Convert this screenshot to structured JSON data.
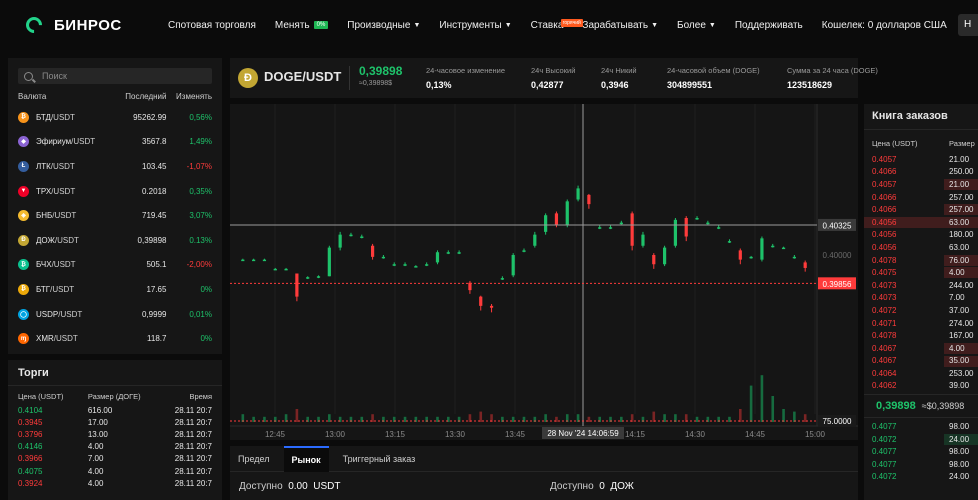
{
  "brand": {
    "name": "БИНРОС"
  },
  "nav": {
    "items": [
      {
        "label": "Спотовая торговля"
      },
      {
        "label": "Менять",
        "badge": "0%"
      },
      {
        "label": "Производные",
        "caret": true
      },
      {
        "label": "Инструменты",
        "caret": true
      },
      {
        "label": "Ставка",
        "badge": "горячий"
      },
      {
        "label": "Зарабатывать",
        "caret": true
      },
      {
        "label": "Более",
        "caret": true
      },
      {
        "label": "Поддерживать"
      },
      {
        "label": "Кошелек: 0 долларов США"
      }
    ],
    "cut_label": "Н"
  },
  "markets": {
    "search_placeholder": "Поиск",
    "headers": {
      "pair": "Валюта",
      "last": "Последний",
      "change": "Изменять"
    },
    "rows": [
      {
        "base": "БТД",
        "quote": "/USDT",
        "last": "95262.99",
        "change": "0,56%",
        "dir": "up",
        "icon": "bitcoin-icon",
        "color": "#f7931a",
        "glyph": "₿"
      },
      {
        "base": "Эфириум",
        "quote": "/USDT",
        "last": "3567.8",
        "change": "1,49%",
        "dir": "up",
        "icon": "ethereum-icon",
        "color": "#8a63d2",
        "glyph": "◆"
      },
      {
        "base": "ЛТК",
        "quote": "/USDT",
        "last": "103.45",
        "change": "-1,07%",
        "dir": "down",
        "icon": "litecoin-icon",
        "color": "#345d9d",
        "glyph": "Ł"
      },
      {
        "base": "ТРХ",
        "quote": "/USDT",
        "last": "0.2018",
        "change": "0,35%",
        "dir": "up",
        "icon": "tron-icon",
        "color": "#ef0027",
        "glyph": "▼"
      },
      {
        "base": "БНБ",
        "quote": "/USDT",
        "last": "719.45",
        "change": "3,07%",
        "dir": "up",
        "icon": "bnb-icon",
        "color": "#f3ba2f",
        "glyph": "◈"
      },
      {
        "base": "ДОЖ",
        "quote": "/USDT",
        "last": "0,39898",
        "change": "0.13%",
        "dir": "up",
        "icon": "dogecoin-icon",
        "color": "#c2a633",
        "glyph": "Ð"
      },
      {
        "base": "БЧХ",
        "quote": "/USDT",
        "last": "505.1",
        "change": "-2,00%",
        "dir": "down",
        "icon": "bitcoin-cash-icon",
        "color": "#0ac18e",
        "glyph": "₿"
      },
      {
        "base": "БТГ",
        "quote": "/USDT",
        "last": "17.65",
        "change": "0%",
        "dir": "up",
        "icon": "bitcoin-gold-icon",
        "color": "#eba809",
        "glyph": "₿"
      },
      {
        "base": "USDP",
        "quote": "/USDT",
        "last": "0,9999",
        "change": "0,01%",
        "dir": "up",
        "icon": "usdp-icon",
        "color": "#00a3e0",
        "glyph": "◯"
      },
      {
        "base": "XMR",
        "quote": "/USDT",
        "last": "118.7",
        "change": "0%",
        "dir": "up",
        "icon": "monero-icon",
        "color": "#ff6600",
        "glyph": "ɱ"
      }
    ]
  },
  "trades": {
    "title": "Торги",
    "headers": {
      "price": "Цена (USDT)",
      "size": "Размер (ДОГЕ)",
      "time": "Время"
    },
    "rows": [
      {
        "price": "0.4104",
        "size": "616.00",
        "time": "28.11 20:7",
        "dir": "up"
      },
      {
        "price": "0.3945",
        "size": "17.00",
        "time": "28.11 20:7",
        "dir": "down"
      },
      {
        "price": "0.3796",
        "size": "13.00",
        "time": "28.11 20:7",
        "dir": "down"
      },
      {
        "price": "0.4146",
        "size": "4.00",
        "time": "28.11 20:7",
        "dir": "up"
      },
      {
        "price": "0.3966",
        "size": "7.00",
        "time": "28.11 20:7",
        "dir": "down"
      },
      {
        "price": "0.4075",
        "size": "4.00",
        "time": "28.11 20:7",
        "dir": "up"
      },
      {
        "price": "0.3924",
        "size": "4.00",
        "time": "28.11 20:7",
        "dir": "down"
      }
    ]
  },
  "ticker": {
    "glyph": "Ð",
    "pair": "DOGE/USDT",
    "price": "0,39898",
    "price_usd": "≈0,39898$",
    "stats": [
      {
        "label": "24-часовое изменение",
        "value": "0,13%",
        "color": "green"
      },
      {
        "label": "24ч Высокий",
        "value": "0,42877"
      },
      {
        "label": "24ч Никий",
        "value": "0,3946"
      },
      {
        "label": "24-часовой объем (DOGE)",
        "value": "304899551"
      },
      {
        "label": "Сумма за 24 часа (DOGE)",
        "value": "123518629"
      }
    ]
  },
  "chart_data": {
    "type": "candlestick",
    "price_ylim": [
      0.388,
      0.412
    ],
    "x_ticks": [
      "12:45",
      "13:00",
      "13:15",
      "13:30",
      "13:45",
      "14:00",
      "14:15",
      "14:30",
      "14:45",
      "15:00"
    ],
    "crosshair": {
      "time_label": "28 Nov '24  14:06:59",
      "price_label": "0.40325",
      "price": 0.40325
    },
    "last_price": {
      "label": "0.39856",
      "value": 0.39856
    },
    "axis_labels": [
      "0.40000"
    ],
    "volume_label": "75.0000",
    "candles": [
      [
        0.3995,
        0.3996,
        0.3994,
        0.3995
      ],
      [
        0.3995,
        0.3996,
        0.3994,
        0.3995
      ],
      [
        0.3995,
        0.3996,
        0.3994,
        0.3995
      ],
      [
        0.3985,
        0.3986,
        0.3984,
        0.3985
      ],
      [
        0.3985,
        0.3986,
        0.3984,
        0.3985
      ],
      [
        0.398,
        0.398,
        0.395,
        0.3955
      ],
      [
        0.3975,
        0.3977,
        0.3974,
        0.3976
      ],
      [
        0.3976,
        0.3978,
        0.3975,
        0.3977
      ],
      [
        0.3977,
        0.401,
        0.3977,
        0.4008
      ],
      [
        0.4008,
        0.4025,
        0.4005,
        0.4022
      ],
      [
        0.4022,
        0.4024,
        0.402,
        0.4022
      ],
      [
        0.402,
        0.4022,
        0.4018,
        0.402
      ],
      [
        0.401,
        0.4012,
        0.3995,
        0.3998
      ],
      [
        0.3998,
        0.4,
        0.3996,
        0.3998
      ],
      [
        0.399,
        0.3992,
        0.3988,
        0.399
      ],
      [
        0.399,
        0.3992,
        0.3988,
        0.399
      ],
      [
        0.3988,
        0.3989,
        0.3987,
        0.3988
      ],
      [
        0.399,
        0.3992,
        0.3988,
        0.399
      ],
      [
        0.3992,
        0.4005,
        0.399,
        0.4003
      ],
      [
        0.4003,
        0.4005,
        0.4001,
        0.4003
      ],
      [
        0.4003,
        0.4005,
        0.4001,
        0.4003
      ],
      [
        0.397,
        0.3972,
        0.3958,
        0.3962
      ],
      [
        0.3955,
        0.3956,
        0.394,
        0.3945
      ],
      [
        0.3945,
        0.3947,
        0.3938,
        0.3943
      ],
      [
        0.3975,
        0.3977,
        0.3973,
        0.3975
      ],
      [
        0.3978,
        0.4002,
        0.3976,
        0.4
      ],
      [
        0.4005,
        0.4007,
        0.4003,
        0.4005
      ],
      [
        0.401,
        0.4025,
        0.4008,
        0.4022
      ],
      [
        0.4025,
        0.4045,
        0.4022,
        0.4043
      ],
      [
        0.4045,
        0.4047,
        0.403,
        0.4033
      ],
      [
        0.4033,
        0.406,
        0.403,
        0.4058
      ],
      [
        0.406,
        0.4075,
        0.4058,
        0.4072
      ],
      [
        0.4065,
        0.4066,
        0.405,
        0.4055
      ],
      [
        0.403,
        0.4032,
        0.4028,
        0.403
      ],
      [
        0.403,
        0.4032,
        0.4028,
        0.403
      ],
      [
        0.4035,
        0.4037,
        0.4033,
        0.4035
      ],
      [
        0.4045,
        0.4047,
        0.4005,
        0.401
      ],
      [
        0.401,
        0.4025,
        0.4008,
        0.4022
      ],
      [
        0.4,
        0.4002,
        0.3985,
        0.399
      ],
      [
        0.399,
        0.401,
        0.3988,
        0.4008
      ],
      [
        0.401,
        0.404,
        0.4008,
        0.4038
      ],
      [
        0.404,
        0.4042,
        0.4015,
        0.402
      ],
      [
        0.404,
        0.4042,
        0.4038,
        0.404
      ],
      [
        0.4035,
        0.4037,
        0.4033,
        0.4035
      ],
      [
        0.403,
        0.4032,
        0.4028,
        0.403
      ],
      [
        0.4015,
        0.4017,
        0.4013,
        0.4015
      ],
      [
        0.4005,
        0.4007,
        0.399,
        0.3995
      ],
      [
        0.3998,
        0.3999,
        0.3996,
        0.3998
      ],
      [
        0.3995,
        0.402,
        0.3993,
        0.4018
      ],
      [
        0.401,
        0.4012,
        0.4008,
        0.401
      ],
      [
        0.4008,
        0.4009,
        0.4007,
        0.4008
      ],
      [
        0.3998,
        0.4,
        0.3996,
        0.3998
      ],
      [
        0.3992,
        0.3994,
        0.3982,
        0.3986
      ]
    ],
    "volumes": [
      3,
      2,
      2,
      2,
      3,
      5,
      2,
      2,
      3,
      2,
      2,
      2,
      3,
      2,
      2,
      2,
      2,
      2,
      2,
      2,
      2,
      3,
      4,
      3,
      2,
      2,
      2,
      2,
      3,
      2,
      3,
      3,
      2,
      2,
      2,
      2,
      3,
      2,
      4,
      3,
      3,
      3,
      2,
      2,
      2,
      2,
      5,
      14,
      18,
      10,
      5,
      4,
      3
    ]
  },
  "order_form": {
    "tabs": [
      "Предел",
      "Рынок",
      "Триггерный заказ"
    ],
    "active_tab": 1,
    "buy": {
      "label": "Доступно",
      "value": "0.00",
      "unit": "USDT"
    },
    "sell": {
      "label": "Доступно",
      "value": "0",
      "unit": "ДОЖ"
    }
  },
  "order_book": {
    "title": "Книга заказов",
    "headers": {
      "price": "Цена (USDT)",
      "amount": "Размер"
    },
    "asks": [
      {
        "price": "0.4057",
        "amount": "21.00",
        "depth": 0
      },
      {
        "price": "0.4066",
        "amount": "250.00",
        "depth": 0
      },
      {
        "price": "0.4057",
        "amount": "21.00",
        "depth": 0.3
      },
      {
        "price": "0.4066",
        "amount": "257.00",
        "depth": 0
      },
      {
        "price": "0.4066",
        "amount": "257.00",
        "depth": 0.3
      },
      {
        "price": "0.4056",
        "amount": "63.00",
        "depth": 1
      },
      {
        "price": "0.4056",
        "amount": "180.00",
        "depth": 0
      },
      {
        "price": "0.4056",
        "amount": "63.00",
        "depth": 0
      },
      {
        "price": "0.4078",
        "amount": "76.00",
        "depth": 0.3
      },
      {
        "price": "0.4075",
        "amount": "4.00",
        "depth": 0.3
      },
      {
        "price": "0.4073",
        "amount": "244.00",
        "depth": 0
      },
      {
        "price": "0.4073",
        "amount": "7.00",
        "depth": 0
      },
      {
        "price": "0.4072",
        "amount": "37.00",
        "depth": 0
      },
      {
        "price": "0.4071",
        "amount": "274.00",
        "depth": 0
      },
      {
        "price": "0.4078",
        "amount": "167.00",
        "depth": 0
      },
      {
        "price": "0.4067",
        "amount": "4.00",
        "depth": 0.3
      },
      {
        "price": "0.4067",
        "amount": "35.00",
        "depth": 0.3
      },
      {
        "price": "0.4064",
        "amount": "253.00",
        "depth": 0
      },
      {
        "price": "0.4062",
        "amount": "39.00",
        "depth": 0
      }
    ],
    "mid_price": "0,39898",
    "mid_usd": "≈$0,39898",
    "bids": [
      {
        "price": "0.4077",
        "amount": "98.00",
        "depth": 0
      },
      {
        "price": "0.4072",
        "amount": "24.00",
        "depth": 0.3
      },
      {
        "price": "0.4077",
        "amount": "98.00",
        "depth": 0
      },
      {
        "price": "0.4077",
        "amount": "98.00",
        "depth": 0
      },
      {
        "price": "0.4072",
        "amount": "24.00",
        "depth": 0
      }
    ]
  },
  "colors": {
    "up": "#1ec26a",
    "down": "#ff3b3b",
    "accent": "#2b6bff"
  }
}
